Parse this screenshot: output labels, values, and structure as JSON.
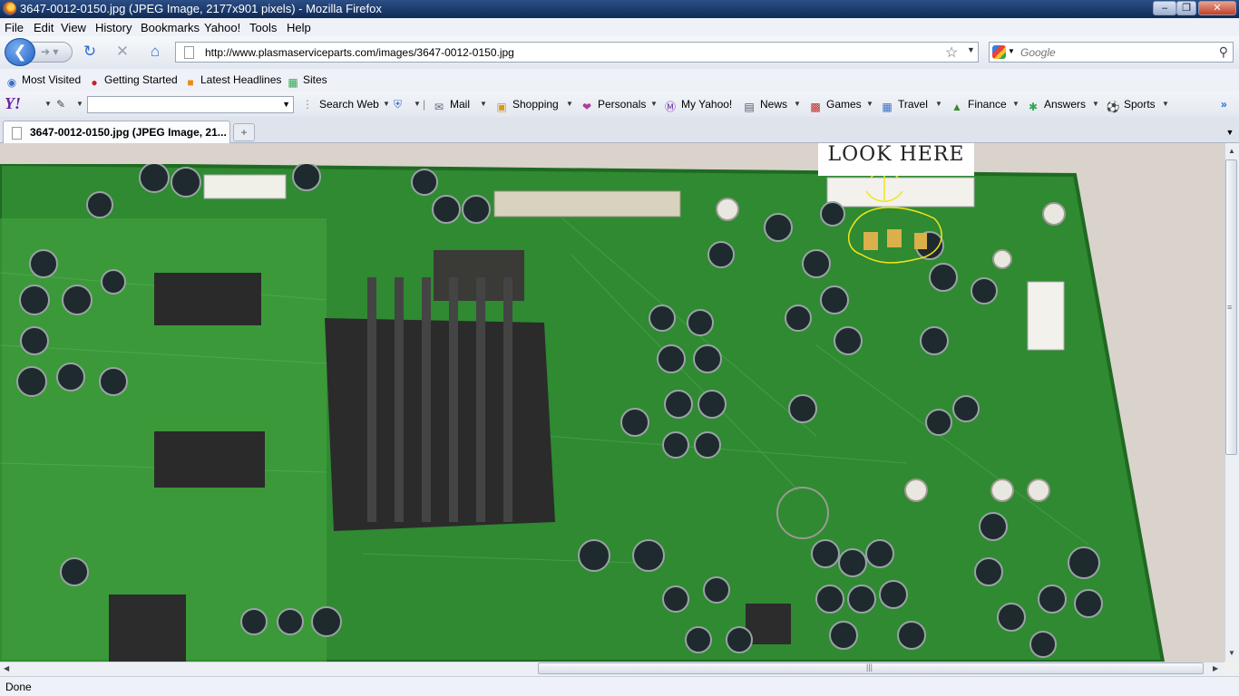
{
  "window": {
    "title": "3647-0012-0150.jpg (JPEG Image, 2177x901 pixels) - Mozilla Firefox"
  },
  "menu": [
    "File",
    "Edit",
    "View",
    "History",
    "Bookmarks",
    "Yahoo!",
    "Tools",
    "Help"
  ],
  "nav": {
    "url": "http://www.plasmaserviceparts.com/images/3647-0012-0150.jpg",
    "search_placeholder": "Google"
  },
  "bookmarks": [
    "Most Visited",
    "Getting Started",
    "Latest Headlines",
    "Sites"
  ],
  "yahoo_toolbar": {
    "search_button": "Search Web",
    "items": [
      "Mail",
      "Shopping",
      "Personals",
      "My Yahoo!",
      "News",
      "Games",
      "Travel",
      "Finance",
      "Answers",
      "Sports"
    ]
  },
  "tabs": [
    {
      "label": "3647-0012-0150.jpg (JPEG Image, 21..."
    }
  ],
  "image": {
    "annotation": "LOOK HERE"
  },
  "status": "Done"
}
